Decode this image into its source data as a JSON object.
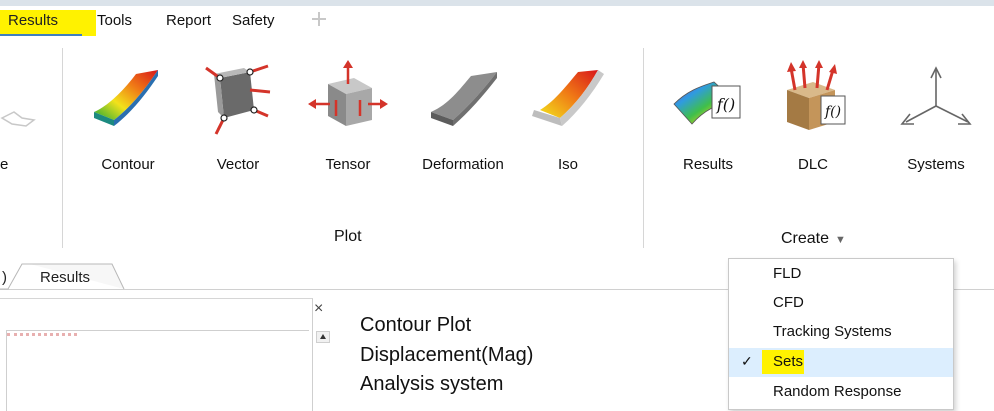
{
  "menu": {
    "items": [
      "Results",
      "Tools",
      "Report",
      "Safety"
    ],
    "active": "Results",
    "add_icon": "plus-icon"
  },
  "ribbon": {
    "partial_left_label": "e",
    "plot_buttons": [
      {
        "label": "Contour",
        "icon": "contour-icon"
      },
      {
        "label": "Vector",
        "icon": "vector-icon"
      },
      {
        "label": "Tensor",
        "icon": "tensor-icon"
      },
      {
        "label": "Deformation",
        "icon": "deformation-icon"
      },
      {
        "label": "Iso",
        "icon": "iso-icon"
      }
    ],
    "plot_group_label": "Plot",
    "create_buttons": [
      {
        "label": "Results",
        "icon": "results-function-icon"
      },
      {
        "label": "DLC",
        "icon": "dlc-icon"
      },
      {
        "label": "Systems",
        "icon": "systems-axes-icon"
      }
    ],
    "create_group_label": "Create"
  },
  "tabs": {
    "partial": ")",
    "results": "Results"
  },
  "panel": {
    "close_label": "×"
  },
  "viewport_info": {
    "line1": "Contour Plot",
    "line2": "Displacement(Mag)",
    "line3": "Analysis system"
  },
  "create_dropdown": {
    "items": [
      {
        "label": "FLD",
        "checked": false
      },
      {
        "label": "CFD",
        "checked": false
      },
      {
        "label": "Tracking Systems",
        "checked": false
      },
      {
        "label": "Sets",
        "checked": true
      },
      {
        "label": "Random Response",
        "checked": false
      }
    ],
    "check_glyph": "✓"
  },
  "colors": {
    "highlight": "#fff200",
    "selected_row": "#dceefe",
    "menu_underline": "#3f7fbf"
  }
}
